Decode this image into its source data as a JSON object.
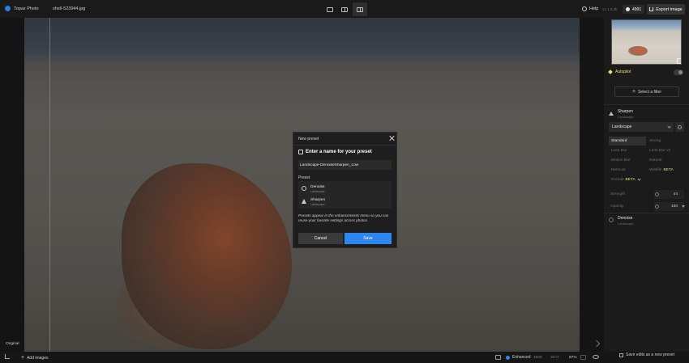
{
  "app": {
    "name": "Topaz Photo",
    "filename": "shell-523944.jpg"
  },
  "topbar": {
    "help_label": "Help",
    "version": "v1.1.0.3b",
    "credits": "4991",
    "export_label": "Export image"
  },
  "dialog": {
    "title": "New preset",
    "heading": "Enter a name for your preset",
    "name_value": "Landscape-DenoiseSharpen_Low",
    "preset_label": "Preset",
    "items": [
      {
        "name": "Denoise",
        "sub": "Landscape",
        "icon": "circle-denoise-icon"
      },
      {
        "name": "Sharpen",
        "sub": "Landscape",
        "icon": "triangle-sharpen-icon"
      }
    ],
    "note": "Presets appear in the enhancements menu so you can reuse your favorite settings across photos.",
    "cancel_label": "Cancel",
    "save_label": "Save"
  },
  "panel": {
    "autopilot_label": "Autopilot",
    "select_filter_label": "Select a filter",
    "sharpen": {
      "title": "Sharpen",
      "subtitle": "Landscape",
      "model": "Landscape",
      "modes": [
        {
          "label": "Standard",
          "selected": true
        },
        {
          "label": "Strong"
        },
        {
          "label": "Lens blur"
        },
        {
          "label": "Lens blur v2"
        },
        {
          "label": "Motion blur"
        },
        {
          "label": "Natural"
        },
        {
          "label": "Refocus"
        },
        {
          "label": "Wildlife",
          "beta": "BETA"
        },
        {
          "label": "Portrait",
          "beta": "BETA"
        }
      ],
      "strength": {
        "label": "Strength",
        "value": "44"
      },
      "opacity": {
        "label": "Opacity",
        "value": "100"
      }
    },
    "denoise": {
      "title": "Denoise",
      "subtitle": "Landscape"
    }
  },
  "bottombar": {
    "original_label": "Original",
    "add_images_label": "Add images",
    "enhanced_label": "Enhanced",
    "width": "4608",
    "height": "3072",
    "zoom": "67%",
    "save_edits_label": "Save edits as a new preset"
  }
}
